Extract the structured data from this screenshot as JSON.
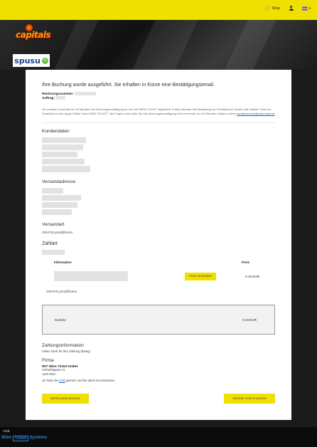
{
  "header": {
    "shop_label": "Shop",
    "icons": {
      "cart": "cart-icon",
      "user": "user-icon",
      "flag": "austria-flag-icon"
    },
    "accent": "#f0e000"
  },
  "brand": {
    "team": "capitals",
    "sponsor": "spusu"
  },
  "confirmation": {
    "heading": "Ihre Buchung wurde ausgeführt. Sie erhalten in Kürze eine Bestätigungsemail.",
    "booking_label": "Rechnungsnummer:",
    "order_label": "Auftrag:",
    "info_text": "Sie erhalten innerhalb von 30 Minuten Ihre Buchungsbestätigung an Ihre bei WIEN TICKET registrierte E-Mail-Adresse. Bei Bestellung von Print@home Tickets oder Mobile Ticket am Smartphone oder Apple Wallet *oder WIEN TICKET*. Bei Fragen oder sollte Sie Ihre Buchungsbestätigung nicht innerhalb von 24 Stunden erhalten haben",
    "info_email": "kundenservice@wien-ticket.at"
  },
  "sections": {
    "kundendaten": "Kundendaten",
    "versandadresse": "Versandadresse",
    "versandart": "Versandart",
    "versandart_value": "GRATIS print@home",
    "zahlart": "Zahlart"
  },
  "table": {
    "col_info": "Information",
    "col_price": "Preis",
    "ticket_button": "TICKET AUSGEBEN",
    "row_price": "0.10 EUR",
    "delivery": "GRATIS print@home",
    "sum_label": "Summe",
    "sum_value": "0.10 EUR"
  },
  "payment": {
    "title": "Zahlungsinformation",
    "text": "Vielen Dank für Ihre Zahlung (Beleg)"
  },
  "company": {
    "title": "Firma",
    "name": "WIT Wien Ticket GmbH",
    "street": "Hofmühlgasse 21",
    "city": "1120 Wien"
  },
  "agb": {
    "prefix": "Ich habe die",
    "link": "AGB",
    "suffix": "gelesen und bin damit einverstanden."
  },
  "actions": {
    "left_button": "BESTELLUNG DRUCKEN",
    "right_button": "WEITERE TICKETS KAUFEN"
  },
  "footer": {
    "agb": "AGB",
    "logo_parts": [
      "Wien",
      "Ticket",
      "Systems"
    ]
  }
}
